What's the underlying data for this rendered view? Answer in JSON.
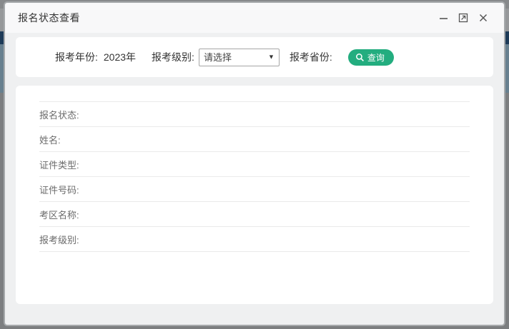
{
  "window": {
    "title": "报名状态查看"
  },
  "form": {
    "year_label": "报考年份:",
    "year_value": "2023年",
    "level_label": "报考级别:",
    "level_selected": "请选择",
    "province_label": "报考省份:",
    "query_button_label": "查询"
  },
  "result_fields": [
    {
      "label": "报名状态:",
      "value": ""
    },
    {
      "label": "姓名:",
      "value": ""
    },
    {
      "label": "证件类型:",
      "value": ""
    },
    {
      "label": "证件号码:",
      "value": ""
    },
    {
      "label": "考区名称:",
      "value": ""
    },
    {
      "label": "报考级别:",
      "value": ""
    }
  ],
  "colors": {
    "accent_green": "#23ad7f",
    "dialog_border": "#a6a9ab",
    "panel_background": "#ffffff",
    "dialog_background": "#eff0f1"
  },
  "icons": {
    "minimize": "minimize-icon",
    "maximize": "maximize-icon",
    "close": "close-icon",
    "search": "search-icon",
    "dropdown": "chevron-down-icon"
  }
}
